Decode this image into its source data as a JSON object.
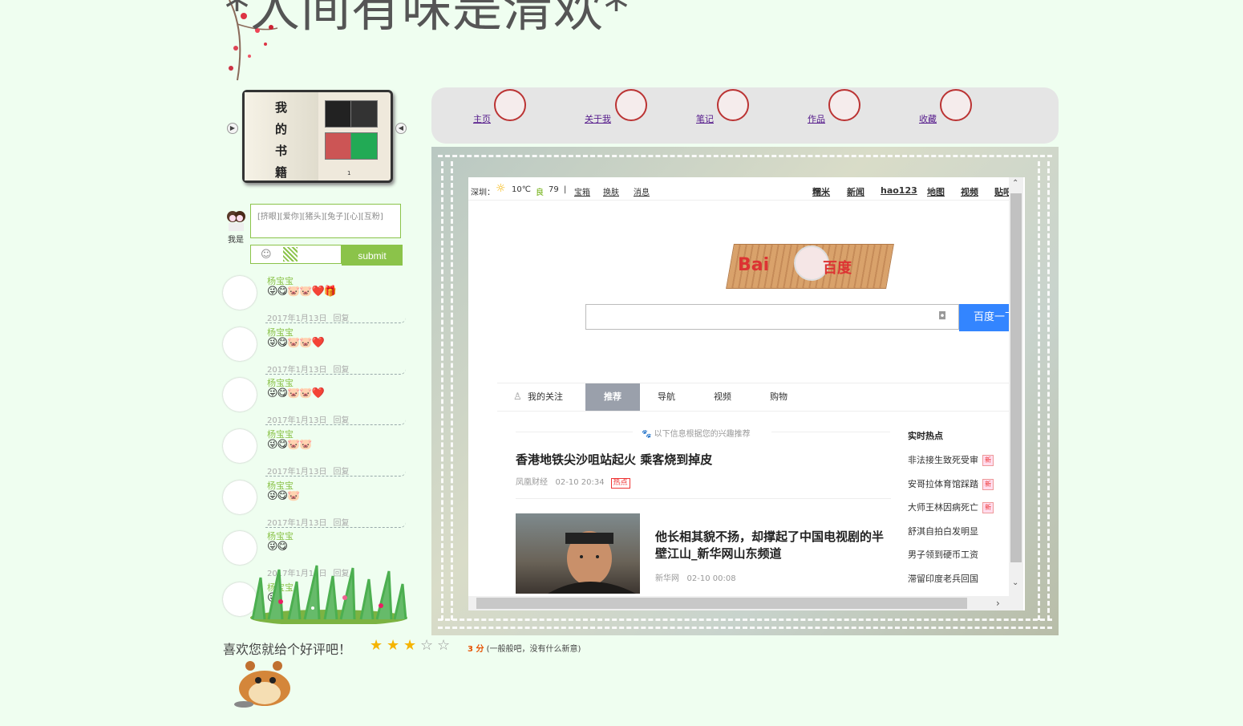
{
  "site": {
    "title": "*人间有味是清欢*"
  },
  "bookshelf": {
    "title": "我的书籍",
    "page": "1"
  },
  "nav": {
    "items": [
      {
        "label": "主页"
      },
      {
        "label": "关于我"
      },
      {
        "label": "笔记"
      },
      {
        "label": "作品"
      },
      {
        "label": "收藏"
      }
    ]
  },
  "comment_form": {
    "user_label": "我是",
    "placeholder": "[挤眼][爱你][猪头][兔子][心][互粉]",
    "submit_label": "submit"
  },
  "comments": [
    {
      "name": "杨宝宝",
      "emojis": "😜😋🐷🐷❤️🎁",
      "date": "2017年1月13日",
      "reply": "回复"
    },
    {
      "name": "杨宝宝",
      "emojis": "😜😋🐷🐷❤️",
      "date": "2017年1月13日",
      "reply": "回复"
    },
    {
      "name": "杨宝宝",
      "emojis": "😜😋🐷🐷❤️",
      "date": "2017年1月13日",
      "reply": "回复"
    },
    {
      "name": "杨宝宝",
      "emojis": "😜😋🐷🐷",
      "date": "2017年1月13日",
      "reply": "回复"
    },
    {
      "name": "杨宝宝",
      "emojis": "😜😋🐷",
      "date": "2017年1月13日",
      "reply": "回复"
    },
    {
      "name": "杨宝宝",
      "emojis": "😜😋",
      "date": "2017年1月13日",
      "reply": "回复"
    },
    {
      "name": "杨宝宝",
      "emojis": "😜",
      "date": "",
      "reply": ""
    }
  ],
  "rating": {
    "label": "喜欢您就给个好评吧！",
    "score": "3 分",
    "desc": "(一般般吧，没有什么新意)",
    "value": 3,
    "max": 5
  },
  "embedded": {
    "topbar": {
      "city": "深圳：",
      "temp": "10℃",
      "aqi_label": "良",
      "aqi": "79",
      "sep": "|",
      "left_links": [
        "宝箱",
        "换肤",
        "消息"
      ],
      "right_links": [
        "糯米",
        "新闻",
        "hao123",
        "地图",
        "视频",
        "贴吧"
      ]
    },
    "logo": {
      "text1": "Bai",
      "text2": "百度"
    },
    "search": {
      "button": "百度一下",
      "value": ""
    },
    "tabs": [
      {
        "label": "我的关注",
        "active": false
      },
      {
        "label": "推荐",
        "active": true
      },
      {
        "label": "导航",
        "active": false
      },
      {
        "label": "视频",
        "active": false
      },
      {
        "label": "购物",
        "active": false
      }
    ],
    "feed_hint": "以下信息根据您的兴趣推荐",
    "news": [
      {
        "title": "香港地铁尖沙咀站起火 乘客烧到掉皮",
        "source": "凤凰财经",
        "time": "02-10 20:34",
        "badge": "热点"
      },
      {
        "title": "他长相其貌不扬，却撑起了中国电视剧的半壁江山_新华网山东频道",
        "source": "新华网",
        "time": "02-10 00:08",
        "badge": ""
      }
    ],
    "hot": {
      "title": "实时热点",
      "new_badge": "新",
      "items": [
        {
          "label": "非法接生致死受审",
          "is_new": true
        },
        {
          "label": "安哥拉体育馆踩踏",
          "is_new": true
        },
        {
          "label": "大师王林因病死亡",
          "is_new": true
        },
        {
          "label": "舒淇自拍白发明显",
          "is_new": false
        },
        {
          "label": "男子领到硬币工资",
          "is_new": false
        },
        {
          "label": "滞留印度老兵回国",
          "is_new": false
        }
      ]
    }
  },
  "colors": {
    "page_bg": "#effef0",
    "accent_green": "#8bc34a",
    "search_blue": "#3385ff",
    "hot_red": "#e33"
  }
}
